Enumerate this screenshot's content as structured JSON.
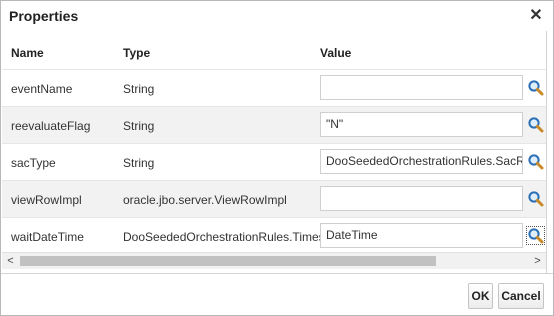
{
  "dialog": {
    "title": "Properties",
    "close_label": "✕"
  },
  "table": {
    "headers": {
      "name": "Name",
      "type": "Type",
      "value": "Value"
    },
    "rows": [
      {
        "name": "eventName",
        "type": "String",
        "value": ""
      },
      {
        "name": "reevaluateFlag",
        "type": "String",
        "value": "\"N\""
      },
      {
        "name": "sacType",
        "type": "String",
        "value": "DooSeededOrchestrationRules.SacResult.S"
      },
      {
        "name": "viewRowImpl",
        "type": "oracle.jbo.server.ViewRowImpl",
        "value": ""
      },
      {
        "name": "waitDateTime",
        "type": "DooSeededOrchestrationRules.Timest...",
        "value": "DateTime"
      }
    ]
  },
  "scrollbar": {
    "left_arrow": "<",
    "right_arrow": ">"
  },
  "footer": {
    "ok_label": "OK",
    "cancel_label": "Cancel"
  },
  "icons": {
    "search": "magnifier-search-icon",
    "close": "close-icon"
  },
  "colors": {
    "search_glass": "#2b6fb5",
    "search_handle": "#c98b2a",
    "row_alt": "#f2f2f2"
  }
}
